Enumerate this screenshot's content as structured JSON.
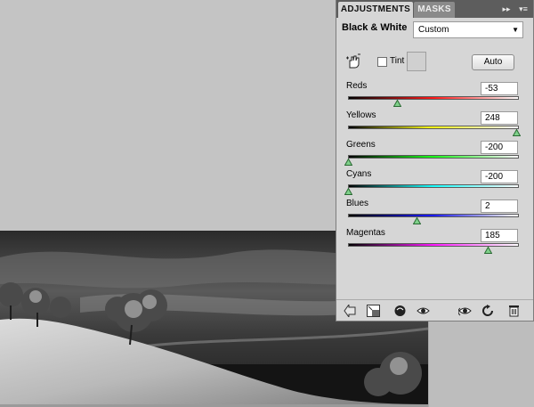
{
  "panel": {
    "tabs": [
      {
        "label": "ADJUSTMENTS",
        "active": true
      },
      {
        "label": "MASKS",
        "active": false
      }
    ],
    "collapse_glyph": "▸▸",
    "menu_glyph": "▾≡",
    "adjustment_title": "Black & White",
    "preset": {
      "selected": "Custom"
    },
    "tint": {
      "label": "Tint",
      "checked": false
    },
    "auto_label": "Auto",
    "sliders": [
      {
        "label": "Reds",
        "value": "-53",
        "level": 0.289
      },
      {
        "label": "Yellows",
        "value": "248",
        "level": 0.982
      },
      {
        "label": "Greens",
        "value": "-200",
        "level": 0.0
      },
      {
        "label": "Cyans",
        "value": "-200",
        "level": 0.0
      },
      {
        "label": "Blues",
        "value": "2",
        "level": 0.4
      },
      {
        "label": "Magentas",
        "value": "185",
        "level": 0.82
      }
    ],
    "footer_icons": [
      "return-to-list-icon",
      "expand-view-icon",
      "clip-to-layer-icon",
      "toggle-visibility-icon",
      "view-previous-state-icon",
      "reset-icon",
      "delete-icon"
    ]
  },
  "colors": {
    "canvas_background": "#c4c4c4",
    "panel_background": "#d6d6d6",
    "tab_bar": "#5d5d5d",
    "thumb_fill": "#7fd08a"
  }
}
